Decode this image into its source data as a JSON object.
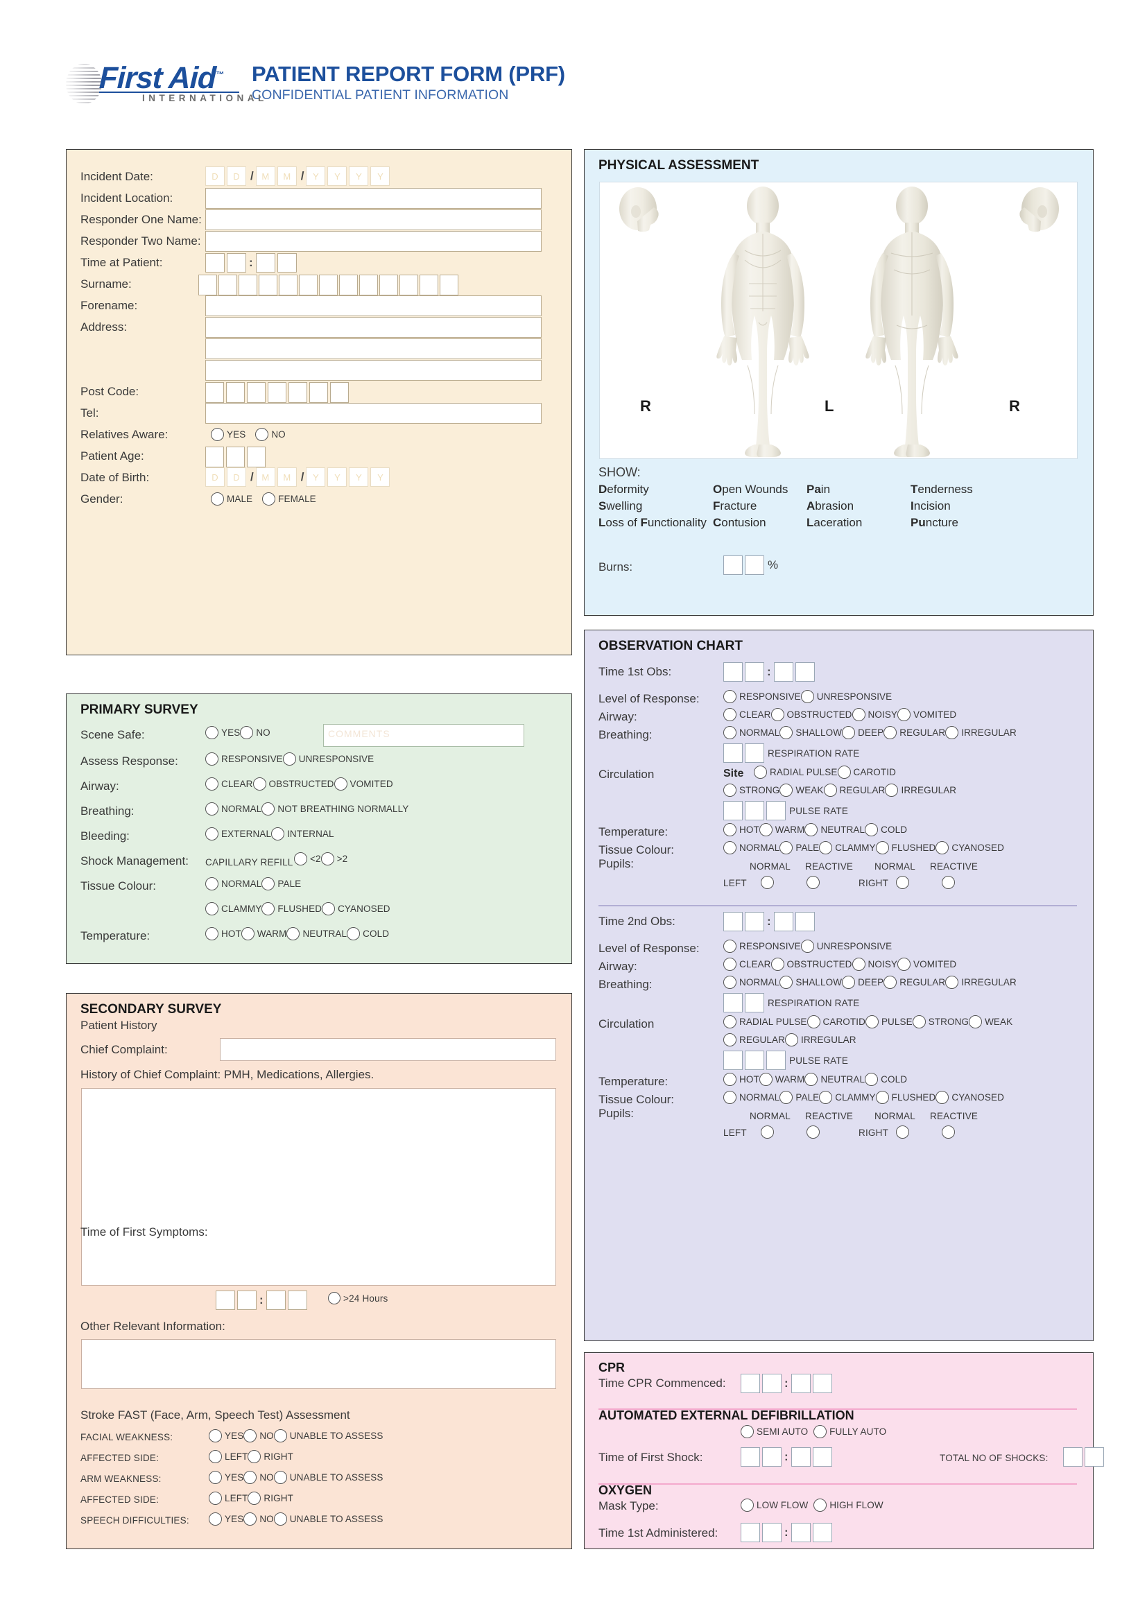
{
  "header": {
    "logo_main": "First Aid",
    "logo_tm": "™",
    "logo_sub": "INTERNATIONAL",
    "title_main": "PATIENT REPORT FORM (PRF)",
    "title_sub": "CONFIDENTIAL PATIENT INFORMATION",
    "brand_color": "#1c4f9c"
  },
  "patient_details": {
    "rows": {
      "incident_date": "Incident Date:",
      "incident_location": "Incident Location:",
      "responder_one": "Responder One Name:",
      "responder_two": "Responder Two Name:",
      "time_at_patient": "Time at Patient:",
      "surname": "Surname:",
      "forename": "Forename:",
      "address": "Address:",
      "post_code": "Post Code:",
      "tel": "Tel:",
      "relatives_aware": "Relatives Aware:",
      "patient_age": "Patient Age:",
      "date_of_birth": "Date of Birth:",
      "gender": "Gender:"
    },
    "date_placeholders": [
      "D",
      "D",
      "M",
      "M",
      "Y",
      "Y",
      "Y",
      "Y"
    ],
    "date_separator": "/",
    "time_separator": ":",
    "relatives_options": [
      "YES",
      "NO"
    ],
    "gender_options": [
      "MALE",
      "FEMALE"
    ],
    "surname_cells": 13,
    "postcode_cells": 7,
    "age_cells": 3,
    "time_cells": 4,
    "panel_color": "#faeed9"
  },
  "primary_survey": {
    "title": "PRIMARY SURVEY",
    "panel_color": "#e3f0e2",
    "comments_placeholder": "COMMENTS",
    "rows": [
      {
        "label": "Scene Safe:",
        "options": [
          "YES",
          "NO"
        ],
        "has_comments": true
      },
      {
        "label": "Assess Response:",
        "options": [
          "RESPONSIVE",
          "UNRESPONSIVE"
        ]
      },
      {
        "label": "Airway:",
        "options": [
          "CLEAR",
          "OBSTRUCTED",
          "VOMITED"
        ]
      },
      {
        "label": "Breathing:",
        "options": [
          "NORMAL",
          "NOT BREATHING NORMALLY"
        ]
      },
      {
        "label": "Bleeding:",
        "options": [
          "EXTERNAL",
          "INTERNAL"
        ]
      },
      {
        "label": "Shock Management:",
        "prefix": "CAPILLARY REFILL",
        "options": [
          "<2",
          ">2"
        ]
      },
      {
        "label": "Tissue Colour:",
        "options": [
          "NORMAL",
          "PALE"
        ]
      },
      {
        "label": "",
        "options": [
          "CLAMMY",
          "FLUSHED",
          "CYANOSED"
        ]
      },
      {
        "label": "Temperature:",
        "options": [
          "HOT",
          "WARM",
          "NEUTRAL",
          "COLD"
        ]
      }
    ]
  },
  "secondary_survey": {
    "title": "SECONDARY SURVEY",
    "subtitle": "Patient History",
    "panel_color": "#fbe4d5",
    "chief_complaint_label": "Chief Complaint:",
    "history_label": "History of Chief Complaint: PMH, Medications, Allergies.",
    "time_first_symptoms_label": "Time of First Symptoms:",
    "time_separator": ":",
    "over_24_hours": ">24 Hours",
    "other_info_label": "Other Relevant Information:",
    "fast_title": "Stroke FAST (Face, Arm, Speech Test) Assessment",
    "fast_rows": [
      {
        "label": "FACIAL WEAKNESS:",
        "options": [
          "YES",
          "NO",
          "UNABLE TO ASSESS"
        ]
      },
      {
        "label": "AFFECTED SIDE:",
        "options": [
          "LEFT",
          "RIGHT"
        ]
      },
      {
        "label": "ARM WEAKNESS:",
        "options": [
          "YES",
          "NO",
          "UNABLE TO ASSESS"
        ]
      },
      {
        "label": "AFFECTED SIDE:",
        "options": [
          "LEFT",
          "RIGHT"
        ]
      },
      {
        "label": "SPEECH DIFFICULTIES:",
        "options": [
          "YES",
          "NO",
          "UNABLE TO ASSESS"
        ]
      }
    ]
  },
  "physical_assessment": {
    "title": "PHYSICAL ASSESSMENT",
    "panel_color": "#e1f1fa",
    "figure_labels": [
      "R",
      "L",
      "R"
    ],
    "show_label": "SHOW:",
    "show_columns": [
      [
        {
          "bold": "D",
          "rest": "eformity"
        },
        {
          "bold": "S",
          "rest": "welling"
        },
        {
          "bold": "L",
          "rest": "oss of ",
          "bold2": "F",
          "rest2": "unctionality"
        }
      ],
      [
        {
          "bold": "O",
          "rest": "pen Wounds"
        },
        {
          "bold": "F",
          "rest": "racture"
        },
        {
          "bold": "C",
          "rest": "ontusion"
        }
      ],
      [
        {
          "bold": "Pa",
          "rest": "in"
        },
        {
          "bold": "A",
          "rest": "brasion"
        },
        {
          "bold": "L",
          "rest": "aceration"
        }
      ],
      [
        {
          "bold": "T",
          "rest": "enderness"
        },
        {
          "bold": "I",
          "rest": "ncision"
        },
        {
          "bold": "Pu",
          "rest": "ncture"
        }
      ]
    ],
    "burns_label": "Burns:",
    "burns_unit": "%",
    "burns_cells": 2
  },
  "observation_chart": {
    "title": "OBSERVATION CHART",
    "panel_color": "#e0dff1",
    "obs": [
      {
        "time_label": "Time 1st Obs:",
        "rows": [
          {
            "label": "Level of Response:",
            "options": [
              "RESPONSIVE",
              "UNRESPONSIVE"
            ]
          },
          {
            "label": "Airway:",
            "options": [
              "CLEAR",
              "OBSTRUCTED",
              "NOISY",
              "VOMITED"
            ]
          },
          {
            "label": "Breathing:",
            "options": [
              "NORMAL",
              "SHALLOW",
              "DEEP",
              "REGULAR",
              "IRREGULAR"
            ]
          },
          {
            "label": "",
            "cells": 2,
            "cells_suffix": "RESPIRATION RATE"
          },
          {
            "label": "Circulation",
            "prefix_bold": "Site",
            "options": [
              "RADIAL PULSE",
              "CAROTID"
            ]
          },
          {
            "label": "",
            "options": [
              "STRONG",
              "WEAK",
              "REGULAR",
              "IRREGULAR"
            ]
          },
          {
            "label": "",
            "cells": 3,
            "cells_suffix": "PULSE RATE"
          },
          {
            "label": "Temperature:",
            "options": [
              "HOT",
              "WARM",
              "NEUTRAL",
              "COLD"
            ]
          },
          {
            "label": "Tissue Colour:",
            "options": [
              "NORMAL",
              "PALE",
              "CLAMMY",
              "FLUSHED",
              "CYANOSED"
            ]
          }
        ],
        "pupils_label": "Pupils:",
        "pupils_headers": [
          "NORMAL",
          "REACTIVE"
        ],
        "pupils_sides": [
          "LEFT",
          "RIGHT"
        ]
      },
      {
        "time_label": "Time 2nd Obs:",
        "rows": [
          {
            "label": "Level of Response:",
            "options": [
              "RESPONSIVE",
              "UNRESPONSIVE"
            ]
          },
          {
            "label": "Airway:",
            "options": [
              "CLEAR",
              "OBSTRUCTED",
              "NOISY",
              "VOMITED"
            ]
          },
          {
            "label": "Breathing:",
            "options": [
              "NORMAL",
              "SHALLOW",
              "DEEP",
              "REGULAR",
              "IRREGULAR"
            ]
          },
          {
            "label": "",
            "cells": 2,
            "cells_suffix": "RESPIRATION RATE"
          },
          {
            "label": "Circulation",
            "options": [
              "RADIAL PULSE",
              "CAROTID",
              "PULSE",
              "STRONG",
              "WEAK"
            ]
          },
          {
            "label": "",
            "options": [
              "REGULAR",
              "IRREGULAR"
            ]
          },
          {
            "label": "",
            "cells": 3,
            "cells_suffix": "PULSE RATE"
          },
          {
            "label": "Temperature:",
            "options": [
              "HOT",
              "WARM",
              "NEUTRAL",
              "COLD"
            ]
          },
          {
            "label": "Tissue Colour:",
            "options": [
              "NORMAL",
              "PALE",
              "CLAMMY",
              "FLUSHED",
              "CYANOSED"
            ]
          }
        ],
        "pupils_label": "Pupils:",
        "pupils_headers": [
          "NORMAL",
          "REACTIVE"
        ],
        "pupils_sides": [
          "LEFT",
          "RIGHT"
        ]
      }
    ],
    "time_separator": ":"
  },
  "cpr_section": {
    "panel_color": "#fbdfec",
    "cpr_title": "CPR",
    "cpr_time_label": "Time CPR Commenced:",
    "aed_title": "AUTOMATED EXTERNAL DEFIBRILLATION",
    "aed_options": [
      "SEMI AUTO",
      "FULLY AUTO"
    ],
    "first_shock_label": "Time of First Shock:",
    "total_shocks_label": "TOTAL NO OF SHOCKS:",
    "total_shocks_cells": 2,
    "oxygen_title": "OXYGEN",
    "mask_type_label": "Mask Type:",
    "mask_options": [
      "LOW FLOW",
      "HIGH FLOW"
    ],
    "oxygen_time_label": "Time 1st Administered:",
    "time_separator": ":"
  }
}
